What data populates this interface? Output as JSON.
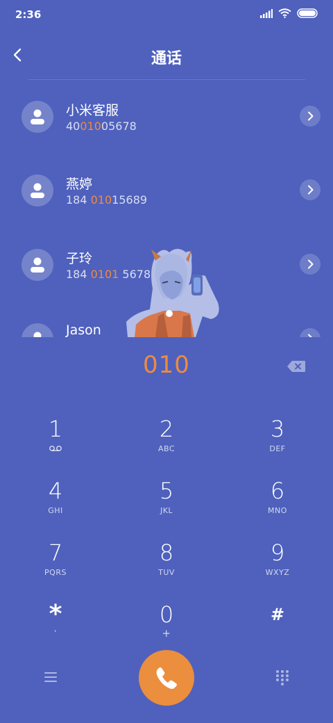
{
  "status_bar": {
    "time": "2:36"
  },
  "header": {
    "title": "通话"
  },
  "contacts": [
    {
      "name": "小米客服",
      "number_parts": [
        "40",
        "010",
        "05678"
      ]
    },
    {
      "name": "燕婷",
      "number_parts": [
        "184 ",
        "010",
        "15689"
      ]
    },
    {
      "name": "子玲",
      "number_parts": [
        "184 ",
        "0101",
        " 5678"
      ]
    },
    {
      "name": "Jason",
      "number_parts": [
        "",
        "",
        ""
      ]
    }
  ],
  "dialer": {
    "input": "010"
  },
  "keypad": [
    {
      "digit": "1",
      "letters": ""
    },
    {
      "digit": "2",
      "letters": "ABC"
    },
    {
      "digit": "3",
      "letters": "DEF"
    },
    {
      "digit": "4",
      "letters": "GHI"
    },
    {
      "digit": "5",
      "letters": "JKL"
    },
    {
      "digit": "6",
      "letters": "MNO"
    },
    {
      "digit": "7",
      "letters": "PQRS"
    },
    {
      "digit": "8",
      "letters": "TUV"
    },
    {
      "digit": "9",
      "letters": "WXYZ"
    },
    {
      "digit": "*",
      "letters": ","
    },
    {
      "digit": "0",
      "letters": "+"
    },
    {
      "digit": "#",
      "letters": ""
    }
  ],
  "icons": {
    "back": "chevron-left-icon",
    "backspace": "backspace-icon",
    "menu": "menu-icon",
    "call": "phone-icon",
    "dialpad": "dialpad-icon",
    "voicemail": "voicemail-icon"
  },
  "colors": {
    "background": "#4f61bd",
    "accent": "#f08a3e",
    "call_button": "#eb8e3e"
  }
}
